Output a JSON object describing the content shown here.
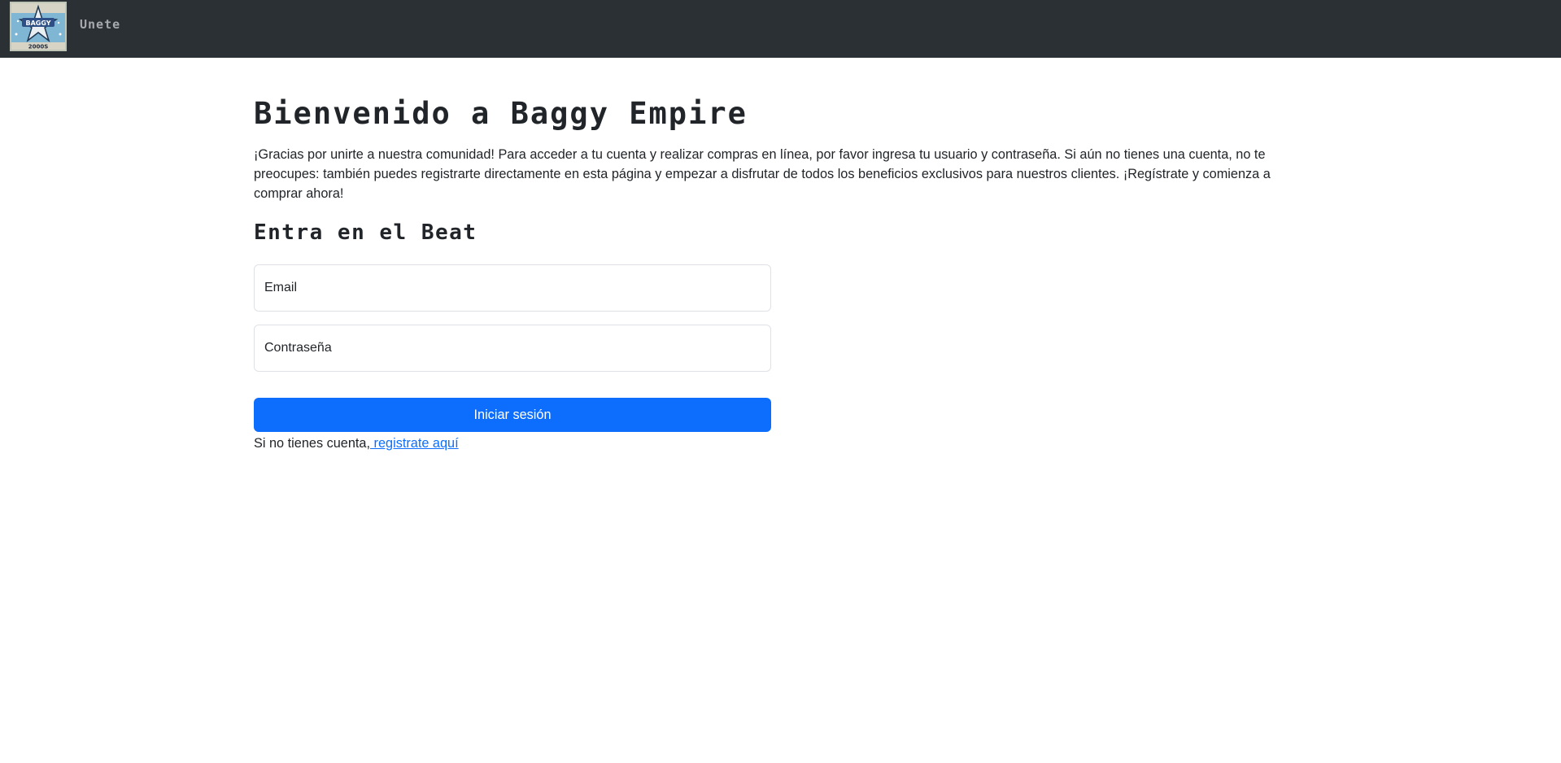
{
  "navbar": {
    "logo_alt": "Baggy Empire logo",
    "logo_text": "BAGGY",
    "logo_subtext": "2000S",
    "nav_link": "Unete"
  },
  "main": {
    "title": "Bienvenido a Baggy Empire",
    "intro": "¡Gracias por unirte a nuestra comunidad! Para acceder a tu cuenta y realizar compras en línea, por favor ingresa tu usuario y contraseña. Si aún no tienes una cuenta, no te preocupes: también puedes registrarte directamente en esta página y empezar a disfrutar de todos los beneficios exclusivos para nuestros clientes. ¡Regístrate y comienza a comprar ahora!",
    "form_title": "Entra en el Beat"
  },
  "form": {
    "email_placeholder": "Email",
    "password_placeholder": "Contraseña",
    "submit_label": "Iniciar sesión",
    "signup_prefix": "Si no tienes cuenta,",
    "signup_link": " registrate aquí"
  },
  "colors": {
    "navbar_bg": "#2b3035",
    "primary": "#0d6efd",
    "text": "#212529",
    "border": "#dee2e6"
  }
}
